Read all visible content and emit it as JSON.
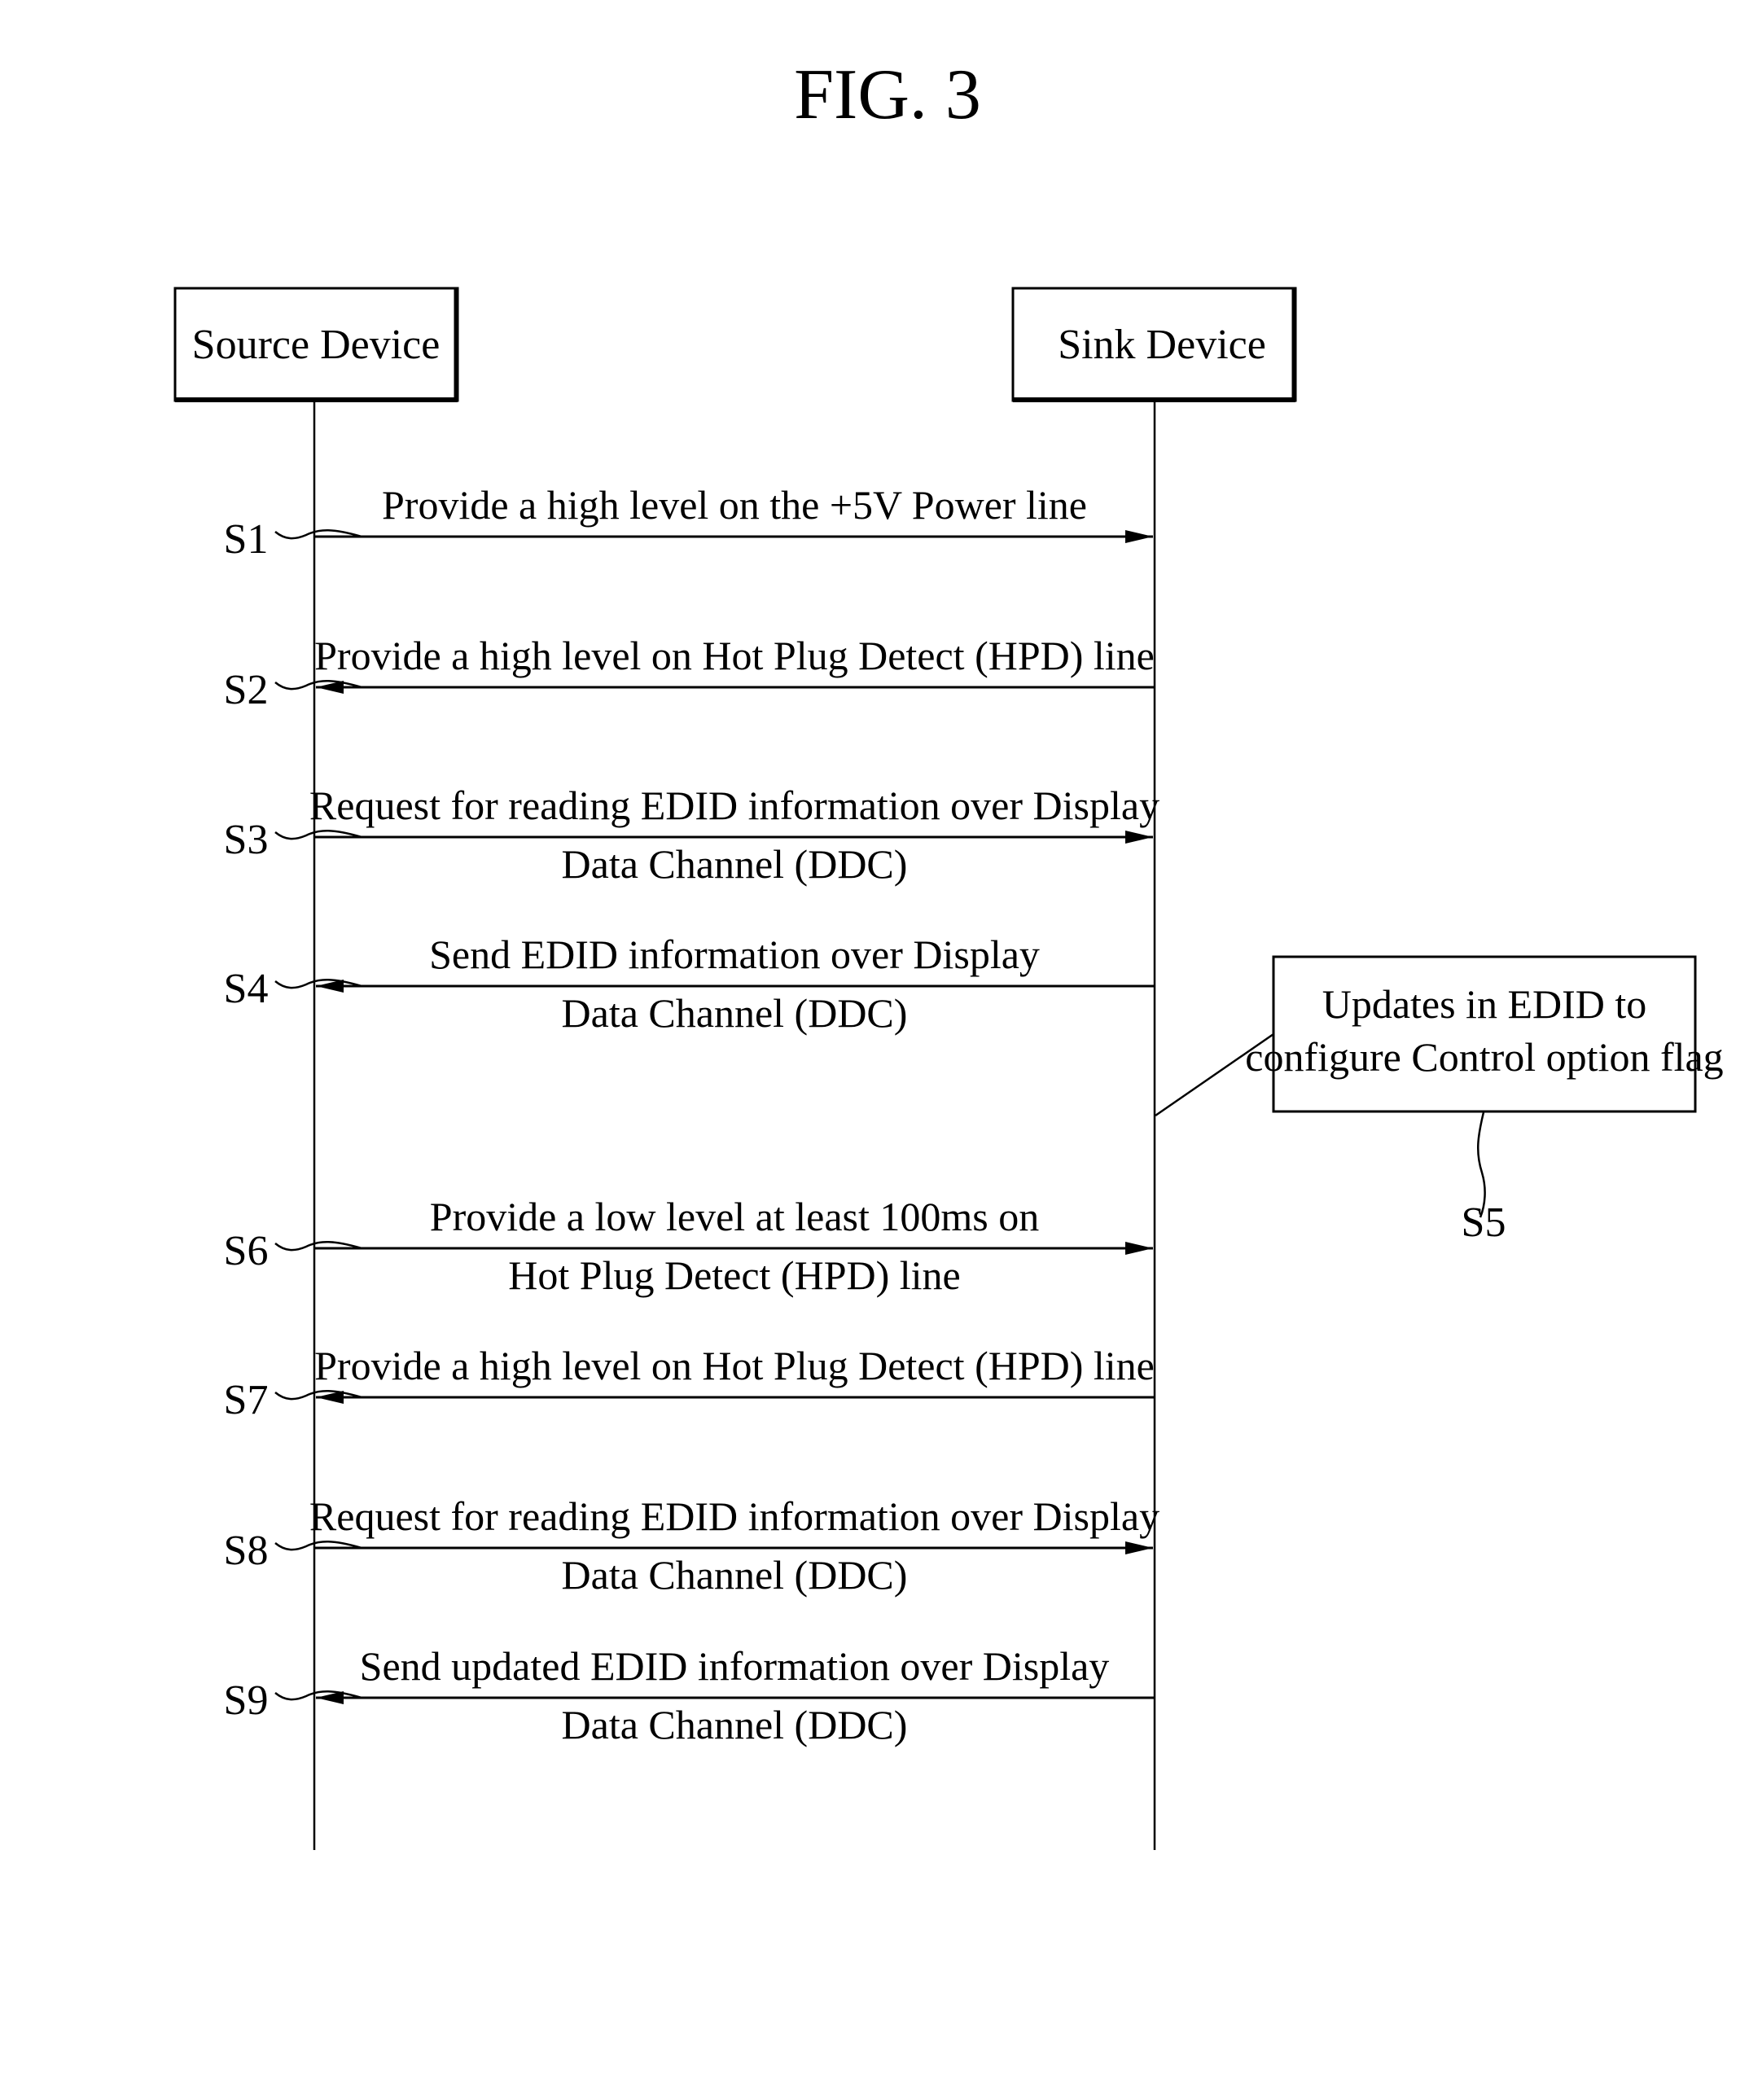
{
  "figure": {
    "title": "FIG. 3"
  },
  "participants": [
    {
      "id": "source",
      "label": "Source Device"
    },
    {
      "id": "sink",
      "label": "Sink Device"
    }
  ],
  "messages": [
    {
      "step": "S1",
      "direction": "source-to-sink",
      "lines": [
        "Provide a high level on the +5V Power line"
      ]
    },
    {
      "step": "S2",
      "direction": "sink-to-source",
      "lines": [
        "Provide a high level on Hot Plug Detect (HPD) line"
      ]
    },
    {
      "step": "S3",
      "direction": "source-to-sink",
      "lines": [
        "Request for reading EDID information over Display",
        "Data Channel (DDC)"
      ]
    },
    {
      "step": "S4",
      "direction": "sink-to-source",
      "lines": [
        "Send EDID information over Display",
        "Data Channel (DDC)"
      ]
    },
    {
      "step": "S6",
      "direction": "source-to-sink",
      "lines": [
        "Provide a low level at least 100ms on",
        "Hot Plug Detect (HPD) line"
      ]
    },
    {
      "step": "S7",
      "direction": "sink-to-source",
      "lines": [
        "Provide a high level on Hot Plug Detect (HPD) line"
      ]
    },
    {
      "step": "S8",
      "direction": "source-to-sink",
      "lines": [
        "Request for reading EDID information over Display",
        "Data Channel (DDC)"
      ]
    },
    {
      "step": "S9",
      "direction": "sink-to-source",
      "lines": [
        "Send updated EDID information over Display",
        "Data Channel (DDC)"
      ]
    }
  ],
  "note": {
    "step": "S5",
    "attached_to": "sink",
    "lines": [
      "Updates in EDID to",
      "configure Control option flag"
    ]
  }
}
